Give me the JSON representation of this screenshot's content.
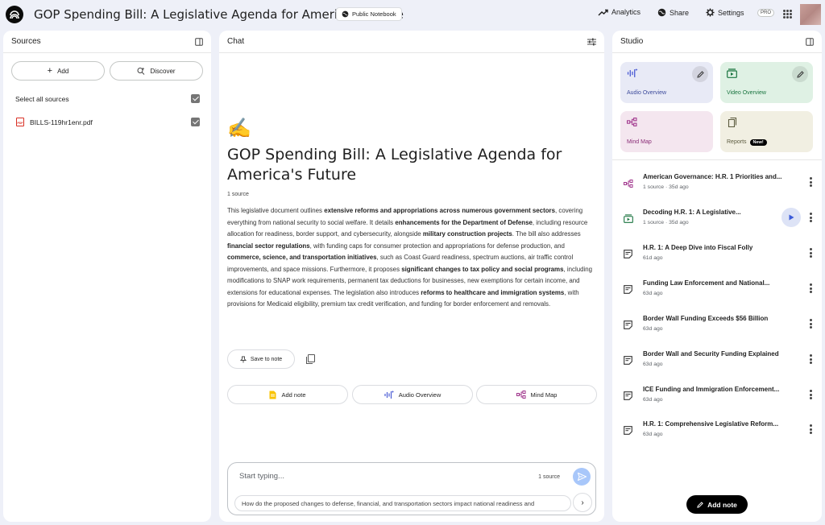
{
  "topbar": {
    "notebook_title": "GOP Spending Bill: A Legislative Agenda for America's Future",
    "public_label": "Public Notebook",
    "analytics_label": "Analytics",
    "share_label": "Share",
    "settings_label": "Settings",
    "pro_badge": "PRO"
  },
  "sources": {
    "title": "Sources",
    "add_label": "Add",
    "discover_label": "Discover",
    "select_all_label": "Select all sources",
    "items": [
      {
        "name": "BILLS-119hr1enr.pdf",
        "icon": "pdf-icon",
        "checked": true
      }
    ]
  },
  "chat": {
    "title": "Chat",
    "emoji": "✍️",
    "notebook_heading": "GOP Spending Bill: A Legislative Agenda for America's Future",
    "source_count": "1 source",
    "summary_segments": [
      {
        "t": "This legislative document outlines ",
        "b": false
      },
      {
        "t": "extensive reforms and appropriations across numerous government sectors",
        "b": true
      },
      {
        "t": ", covering everything from national security to social welfare. It details ",
        "b": false
      },
      {
        "t": "enhancements for the Department of Defense",
        "b": true
      },
      {
        "t": ", including resource allocation for readiness, border support, and cybersecurity, alongside ",
        "b": false
      },
      {
        "t": "military construction projects",
        "b": true
      },
      {
        "t": ". The bill also addresses ",
        "b": false
      },
      {
        "t": "financial sector regulations",
        "b": true
      },
      {
        "t": ", with funding caps for consumer protection and appropriations for defense production, and ",
        "b": false
      },
      {
        "t": "commerce, science, and transportation initiatives",
        "b": true
      },
      {
        "t": ", such as Coast Guard readiness, spectrum auctions, air traffic control improvements, and space missions. Furthermore, it proposes ",
        "b": false
      },
      {
        "t": "significant changes to tax policy and social programs",
        "b": true
      },
      {
        "t": ", including modifications to SNAP work requirements, permanent tax deductions for businesses, new exemptions for certain income, and extensions for educational expenses. The legislation also introduces ",
        "b": false
      },
      {
        "t": "reforms to healthcare and immigration systems",
        "b": true
      },
      {
        "t": ", with provisions for Medicaid eligibility, premium tax credit verification, and funding for border enforcement and removals.",
        "b": false
      }
    ],
    "save_to_note_label": "Save to note",
    "chips": [
      "Add note",
      "Audio Overview",
      "Mind Map"
    ],
    "composer": {
      "placeholder": "Start typing...",
      "source_count": "1 source",
      "suggestion": "How do the proposed changes to defense, financial, and transportation sectors impact national readiness and"
    }
  },
  "studio": {
    "title": "Studio",
    "cards": [
      {
        "label": "Audio Overview",
        "color": "#e8eaf6"
      },
      {
        "label": "Video Overview",
        "color": "#dff1e4"
      },
      {
        "label": "Mind Map",
        "color": "#f4e6ef"
      },
      {
        "label": "Reports",
        "badge": "New!",
        "color": "#f1efe2"
      }
    ],
    "notes": [
      {
        "title": "American Governance: H.R. 1 Priorities and...",
        "meta": "1 source · 35d ago",
        "icon": "mind-map-icon"
      },
      {
        "title": "Decoding H.R. 1: A Legislative...",
        "meta": "1 source · 35d ago",
        "icon": "video-icon"
      },
      {
        "title": "H.R. 1: A Deep Dive into Fiscal Folly",
        "meta": "61d ago",
        "icon": "note-icon"
      },
      {
        "title": "Funding Law Enforcement and National...",
        "meta": "63d ago",
        "icon": "note-icon"
      },
      {
        "title": "Border Wall Funding Exceeds $56 Billion",
        "meta": "63d ago",
        "icon": "note-icon"
      },
      {
        "title": "Border Wall and Security Funding Explained",
        "meta": "63d ago",
        "icon": "note-icon"
      },
      {
        "title": "ICE Funding and Immigration Enforcement...",
        "meta": "63d ago",
        "icon": "note-icon"
      },
      {
        "title": "H.R. 1: Comprehensive Legislative Reform...",
        "meta": "63d ago",
        "icon": "note-icon"
      }
    ],
    "add_note_label": "Add note"
  }
}
